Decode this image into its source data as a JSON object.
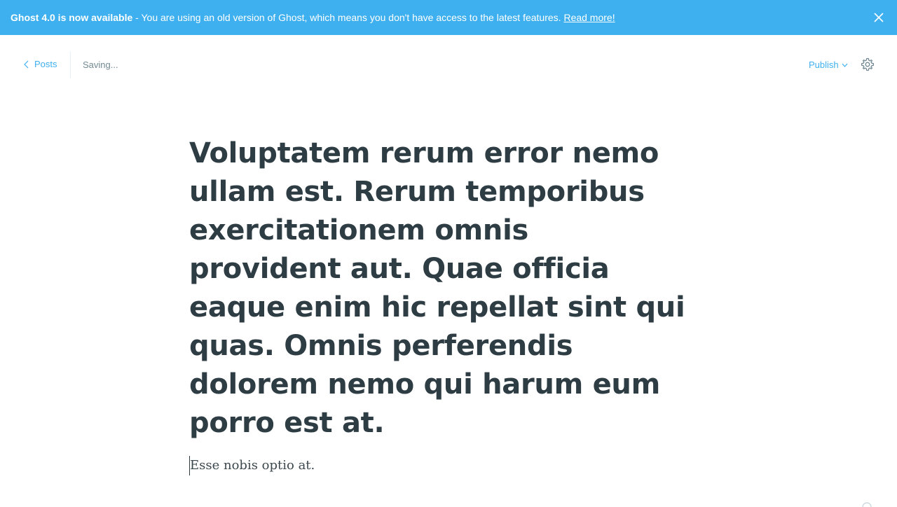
{
  "banner": {
    "strong_text": "Ghost 4.0 is now available",
    "message": " - You are using an old version of Ghost, which means you don't have access to the latest features. ",
    "link_text": "Read more!",
    "background_color": "#3eb0ef",
    "close_icon": "close-icon"
  },
  "header": {
    "back_label": "Posts",
    "back_icon": "chevron-left-icon",
    "status_text": "Saving...",
    "publish_label": "Publish",
    "publish_icon": "chevron-down-icon",
    "settings_icon": "gear-icon",
    "accent_color": "#3eb0ef"
  },
  "editor": {
    "title": "Voluptatem rerum error nemo ullam est. Rerum temporibus exercitationem omnis provident aut. Quae officia eaque enim hic repellat sint qui quas. Omnis perferendis dolorem nemo qui harum eum porro est at.",
    "body": "Esse nobis optio at.",
    "title_color": "#2e3c44"
  }
}
